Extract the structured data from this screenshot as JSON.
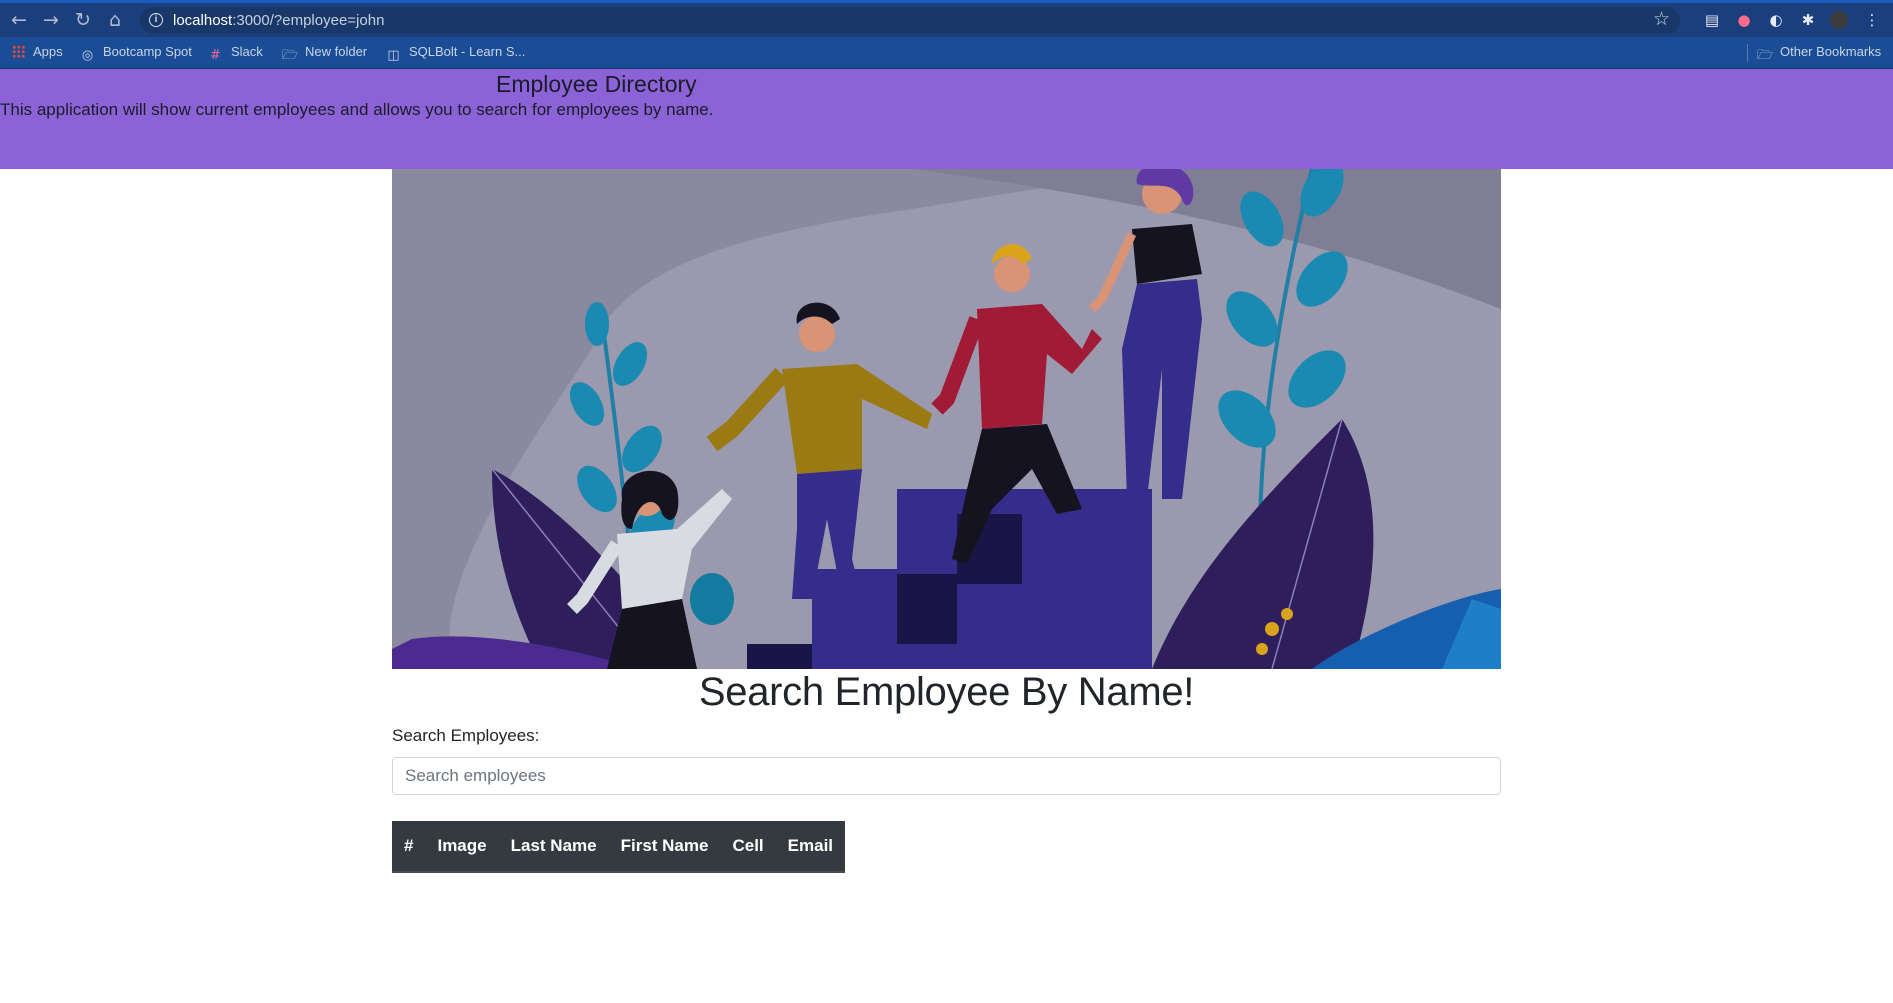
{
  "browser": {
    "url_host": "localhost",
    "url_rest": ":3000/?employee=john",
    "bookmarks": [
      {
        "label": "Apps",
        "icon": "apps-grid-icon"
      },
      {
        "label": "Bootcamp Spot",
        "icon": "globe-icon"
      },
      {
        "label": "Slack",
        "icon": "slack-icon"
      },
      {
        "label": "New folder",
        "icon": "folder-icon"
      },
      {
        "label": "SQLBolt - Learn S...",
        "icon": "database-icon"
      }
    ],
    "other_bookmarks": "Other Bookmarks"
  },
  "header": {
    "title": "Employee Directory",
    "subtitle": "This application will show current employees and allows you to search for employees by name."
  },
  "search": {
    "title": "Search Employee By Name!",
    "label": "Search Employees:",
    "placeholder": "Search employees",
    "value": ""
  },
  "table": {
    "columns": [
      "#",
      "Image",
      "Last Name",
      "First Name",
      "Cell",
      "Email"
    ],
    "rows": []
  },
  "colors": {
    "header_bg": "#8b63d6",
    "table_head_bg": "#343a40",
    "chrome_bg": "#1b3f7c"
  }
}
